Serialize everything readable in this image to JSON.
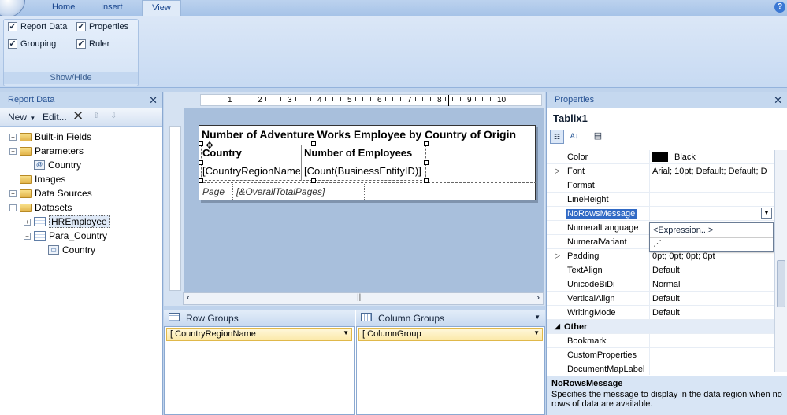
{
  "ribbon": {
    "tabs": [
      "Home",
      "Insert",
      "View"
    ],
    "help": "?"
  },
  "showhide": {
    "label": "Show/Hide",
    "items": [
      {
        "label": "Report Data",
        "checked": true
      },
      {
        "label": "Properties",
        "checked": true
      },
      {
        "label": "Grouping",
        "checked": true
      },
      {
        "label": "Ruler",
        "checked": true
      }
    ]
  },
  "report_data": {
    "title": "Report Data",
    "close": "✕",
    "new_label": "New",
    "edit_label": "Edit...",
    "tree": [
      {
        "label": "Built-in Fields",
        "expander": "+",
        "icon": "folder"
      },
      {
        "label": "Parameters",
        "expander": "−",
        "icon": "folder"
      },
      {
        "label": "Country",
        "expander": "",
        "icon": "parameter"
      },
      {
        "label": "Images",
        "expander": "",
        "icon": "folder"
      },
      {
        "label": "Data Sources",
        "expander": "+",
        "icon": "folder"
      },
      {
        "label": "Datasets",
        "expander": "−",
        "icon": "folder"
      },
      {
        "label": "HREmployee",
        "expander": "+",
        "icon": "dataset"
      },
      {
        "label": "Para_Country",
        "expander": "−",
        "icon": "dataset"
      },
      {
        "label": "Country",
        "expander": "",
        "icon": "field"
      }
    ]
  },
  "designer": {
    "ruler_marks": [
      "1",
      "2",
      "3",
      "4",
      "5",
      "6",
      "7",
      "8",
      "9",
      "10"
    ],
    "title": "Number of Adventure Works Employee by Country of Origin",
    "header_cells": [
      "Country",
      "Number of Employees"
    ],
    "data_cells": [
      "[CountryRegionName",
      "[Count(BusinessEntityID)]"
    ],
    "footer_cells": [
      "Page",
      "[&OverallTotalPages]"
    ]
  },
  "groups": {
    "row_title": "Row Groups",
    "col_title": "Column Groups",
    "row_field": "CountryRegionName",
    "col_field": "ColumnGroup"
  },
  "properties": {
    "title": "Properties",
    "close": "✕",
    "object": "Tablix1",
    "rows": [
      {
        "name": "Color",
        "value": "Black",
        "swatch": "#000000"
      },
      {
        "name": "Font",
        "value": "Arial; 10pt; Default; Default; D",
        "expand": true
      },
      {
        "name": "Format",
        "value": ""
      },
      {
        "name": "LineHeight",
        "value": ""
      },
      {
        "name": "NoRowsMessage",
        "value": "",
        "selected": true
      },
      {
        "name": "NumeralLanguage",
        "value": ""
      },
      {
        "name": "NumeralVariant",
        "value": ""
      },
      {
        "name": "Padding",
        "value": "0pt; 0pt; 0pt; 0pt",
        "expand": true
      },
      {
        "name": "TextAlign",
        "value": "Default"
      },
      {
        "name": "UnicodeBiDi",
        "value": "Normal"
      },
      {
        "name": "VerticalAlign",
        "value": "Default"
      },
      {
        "name": "WritingMode",
        "value": "Default"
      },
      {
        "name": "Other",
        "value": "",
        "category": true
      },
      {
        "name": "Bookmark",
        "value": ""
      },
      {
        "name": "CustomProperties",
        "value": ""
      },
      {
        "name": "DocumentMapLabel",
        "value": ""
      }
    ],
    "dropdown_option": "<Expression...>",
    "desc_title": "NoRowsMessage",
    "desc_text": "Specifies the message to display in the data region when no rows of data are available."
  }
}
